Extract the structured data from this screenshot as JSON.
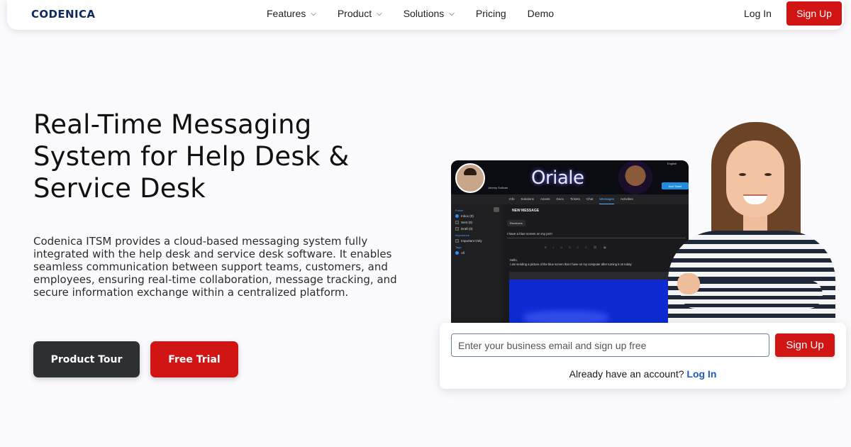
{
  "brand": {
    "name": "CODENICA",
    "color": "#0e2a5c"
  },
  "nav": {
    "items": [
      {
        "label": "Features",
        "has_dropdown": true
      },
      {
        "label": "Product",
        "has_dropdown": true
      },
      {
        "label": "Solutions",
        "has_dropdown": true
      },
      {
        "label": "Pricing",
        "has_dropdown": false
      },
      {
        "label": "Demo",
        "has_dropdown": false
      }
    ],
    "login_label": "Log In",
    "signup_label": "Sign Up",
    "chevron": "⌵"
  },
  "hero": {
    "title_lines": [
      "Real-Time Messaging",
      "System for Help Desk &",
      "Service Desk"
    ],
    "description": "Codenica ITSM provides a cloud-based messaging system fully integrated with the help desk and service desk software. It enables seamless communication between support teams, customers, and employees, ensuring real-time collaboration, message tracking, and secure information exchange within a centralized platform.",
    "tour_label": "Product Tour",
    "trial_label": "Free Trial"
  },
  "app_preview": {
    "brand": "Oriale",
    "user": "Johnny Sullivan",
    "language": "English",
    "add_ticket": "Add Ticket",
    "tabs": [
      "Info",
      "Solutions",
      "Assets",
      "Docs",
      "Tickets",
      "Chat",
      "Messages",
      "Activities"
    ],
    "active_tab": "Messages",
    "sidebar": {
      "folder_heading": "Folder",
      "folders": [
        "Inbox (0)",
        "Sent (0)",
        "Draft (0)"
      ],
      "importance_heading": "Importance",
      "importance_item": "Important Only",
      "tags_heading": "Tags",
      "tags_item": "All"
    },
    "new_message": "NEW MESSAGE",
    "receivers": "Receivers",
    "subject": "I have a blue screen on my pc!!!",
    "body_lines": [
      "Hello,",
      "I am sending a picture of the blue screen that I have on my computer after turning it on today"
    ]
  },
  "signup": {
    "placeholder": "Enter your business email and sign up free",
    "button_label": "Sign Up",
    "already_text": "Already have an account?",
    "login_link": "Log In"
  },
  "colors": {
    "accent": "#d11414",
    "dark_button": "#2d3032",
    "link": "#1e5bb8"
  }
}
